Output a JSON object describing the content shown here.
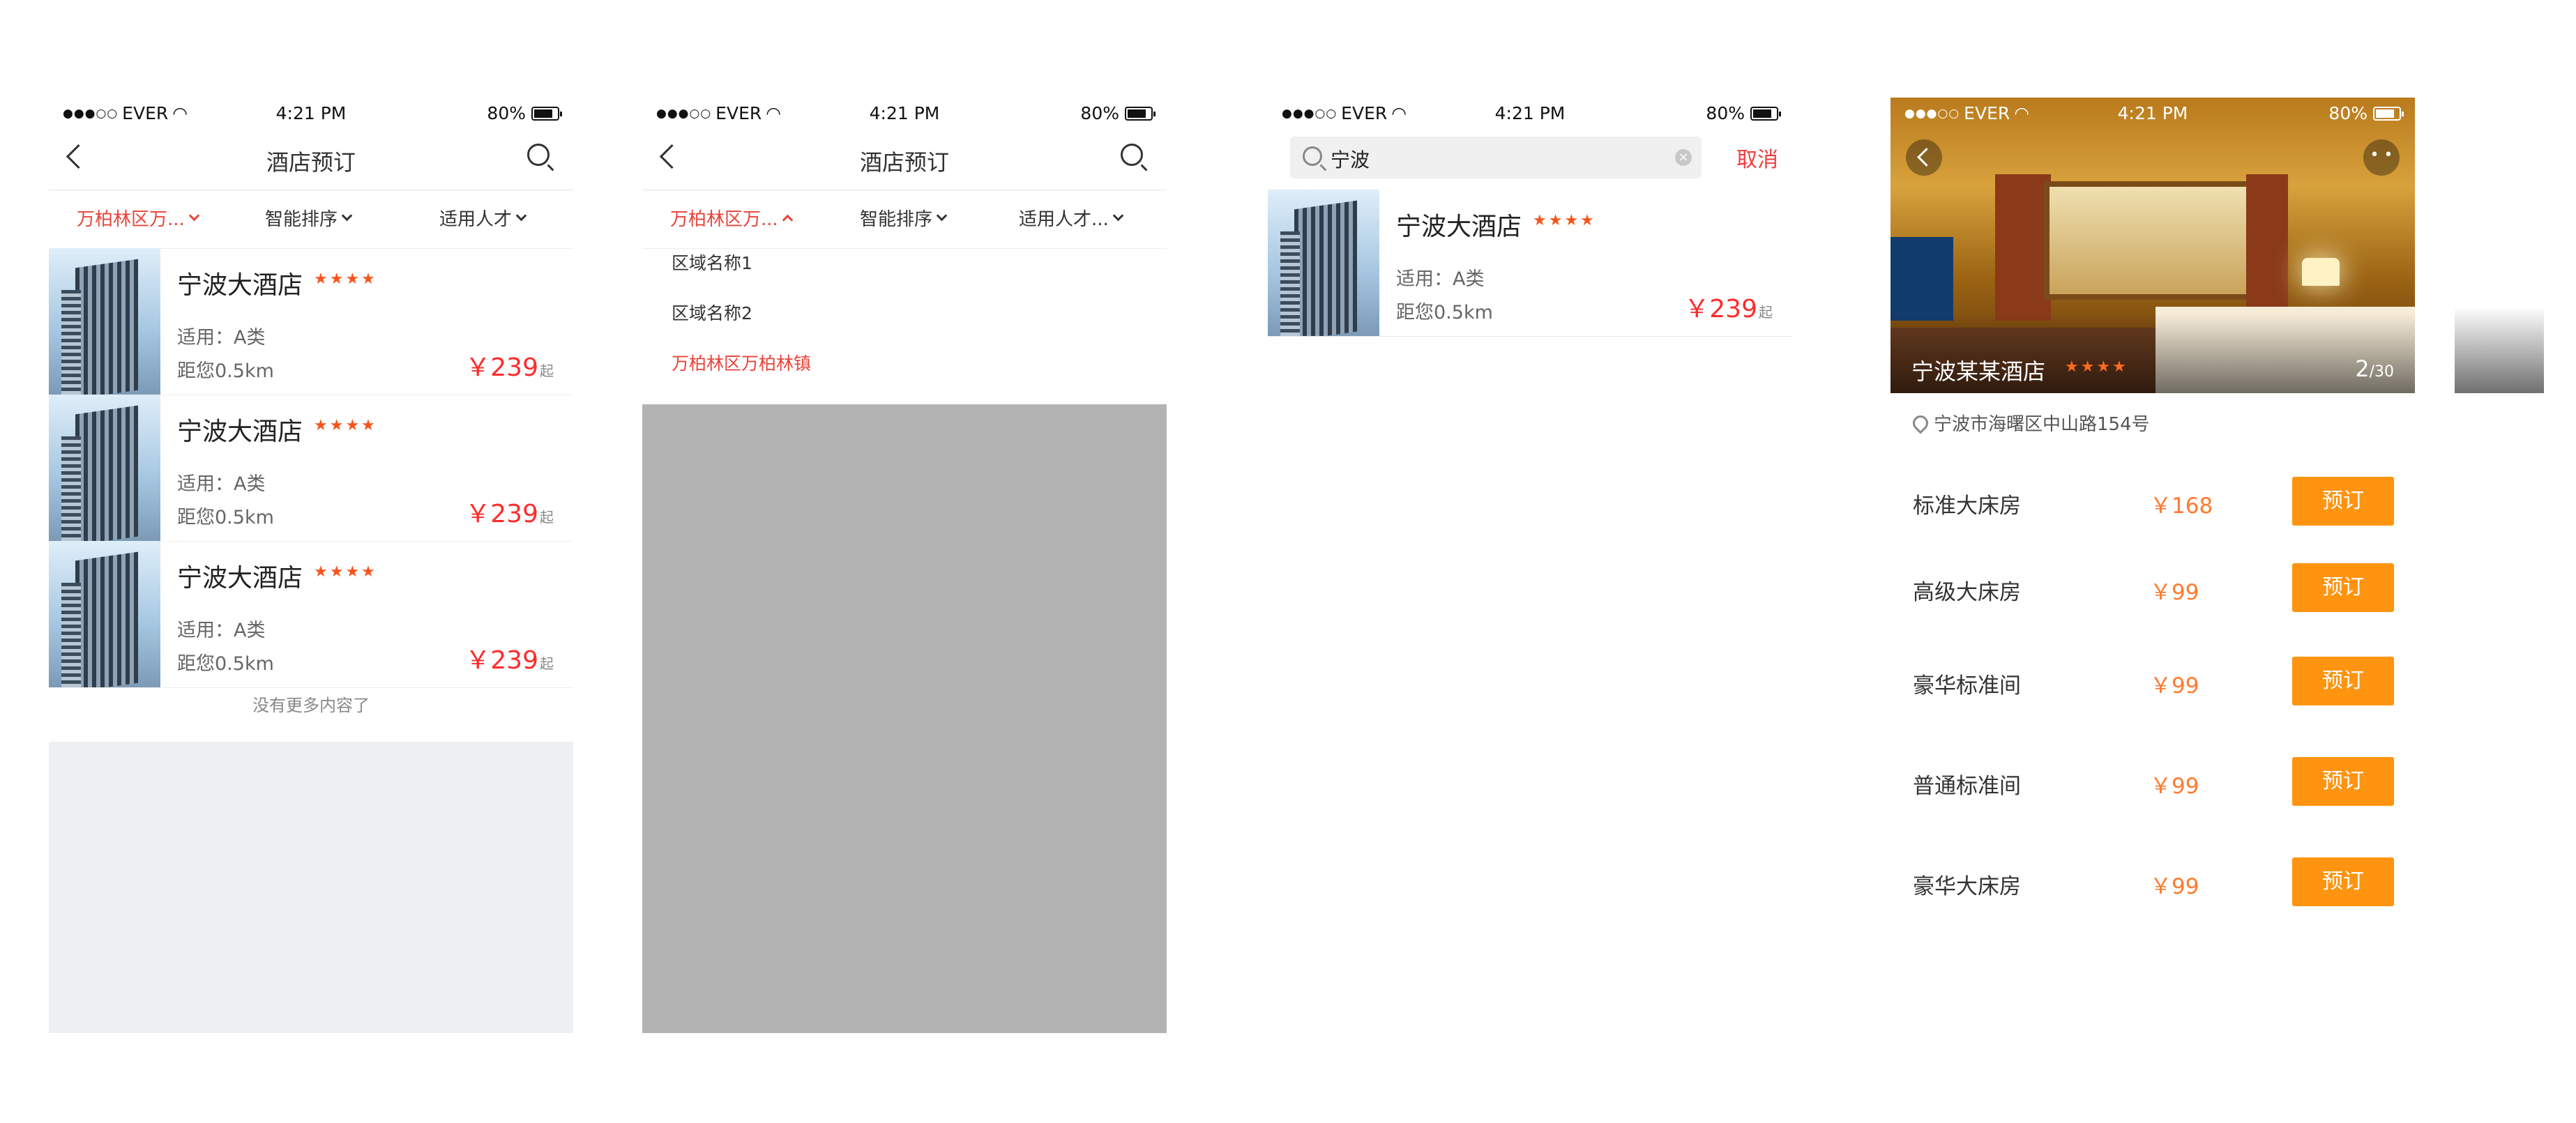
{
  "status_bar": {
    "carrier": "EVER",
    "time": "4:21 PM",
    "battery": "80%"
  },
  "screen1": {
    "title": "酒店预订",
    "filters": [
      {
        "label": "万柏林区万..."
      },
      {
        "label": "智能排序"
      },
      {
        "label": "适用人才"
      }
    ],
    "hotels": [
      {
        "name": "宁波大酒店",
        "stars": "★★★★",
        "type": "适用：A类",
        "distance": "距您0.5km",
        "price": "￥239",
        "price_suffix": "起"
      },
      {
        "name": "宁波大酒店",
        "stars": "★★★★",
        "type": "适用：A类",
        "distance": "距您0.5km",
        "price": "￥239",
        "price_suffix": "起"
      },
      {
        "name": "宁波大酒店",
        "stars": "★★★★",
        "type": "适用：A类",
        "distance": "距您0.5km",
        "price": "￥239",
        "price_suffix": "起"
      }
    ],
    "no_more": "没有更多内容了"
  },
  "screen2": {
    "title": "酒店预订",
    "filters": [
      {
        "label": "万柏林区万..."
      },
      {
        "label": "智能排序"
      },
      {
        "label": "适用人才..."
      }
    ],
    "regions": [
      {
        "label": "区域名称1"
      },
      {
        "label": "区域名称2"
      },
      {
        "label": "万柏林区万柏林镇"
      }
    ]
  },
  "screen3": {
    "search_value": "宁波",
    "cancel_label": "取消",
    "clear_symbol": "×",
    "hotel": {
      "name": "宁波大酒店",
      "stars": "★★★★",
      "type": "适用：A类",
      "distance": "距您0.5km",
      "price": "￥239",
      "price_suffix": "起"
    }
  },
  "screen4": {
    "hotel_name": "宁波某某酒店",
    "stars": "★★★★",
    "photo_index": "2",
    "photo_total": "/30",
    "address": "宁波市海曙区中山路154号",
    "book_label": "预订",
    "rooms": [
      {
        "name": "标准大床房",
        "price": "￥168"
      },
      {
        "name": "高级大床房",
        "price": "￥99"
      },
      {
        "name": "豪华标准间",
        "price": "￥99"
      },
      {
        "name": "普通标准间",
        "price": "￥99"
      },
      {
        "name": "豪华大床房",
        "price": "￥99"
      }
    ]
  },
  "colors": {
    "accent_red": "#e8443a",
    "price_red": "#ff2b2b",
    "book_orange": "#ff9410",
    "star_orange": "#f5551d",
    "mask_grey": "#b3b3b3"
  }
}
